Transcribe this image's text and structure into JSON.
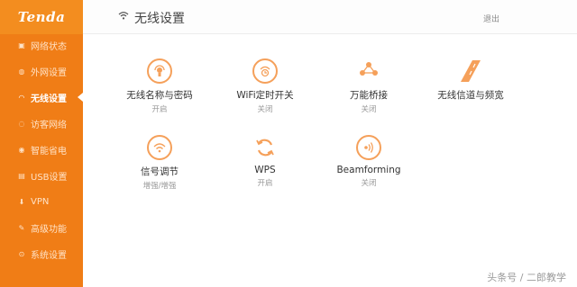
{
  "brand": {
    "logo": "Tenda",
    "accent": "#f07d16",
    "icon_color": "#f5a05a"
  },
  "sidebar": {
    "items": [
      {
        "label": "网络状态",
        "icon": "network-status-icon",
        "glyph": "▣",
        "active": false
      },
      {
        "label": "外网设置",
        "icon": "globe-icon",
        "glyph": "◍",
        "active": false
      },
      {
        "label": "无线设置",
        "icon": "wifi-icon",
        "glyph": "◠",
        "active": true
      },
      {
        "label": "访客网络",
        "icon": "guest-network-icon",
        "glyph": "◌",
        "active": false
      },
      {
        "label": "智能省电",
        "icon": "bulb-icon",
        "glyph": "◉",
        "active": false
      },
      {
        "label": "USB设置",
        "icon": "usb-icon",
        "glyph": "▤",
        "active": false
      },
      {
        "label": "VPN",
        "icon": "vpn-icon",
        "glyph": "⬇",
        "active": false
      },
      {
        "label": "高级功能",
        "icon": "tools-icon",
        "glyph": "✎",
        "active": false
      },
      {
        "label": "系统设置",
        "icon": "settings-icon",
        "glyph": "⊙",
        "active": false
      }
    ]
  },
  "header": {
    "title": "无线设置",
    "logout": "退出"
  },
  "tiles": [
    {
      "label": "无线名称与密码",
      "status": "开启",
      "icon": "signal-lock-icon"
    },
    {
      "label": "WiFi定时开关",
      "status": "关闭",
      "icon": "timer-icon"
    },
    {
      "label": "万能桥接",
      "status": "关闭",
      "icon": "bridge-icon"
    },
    {
      "label": "无线信道与频宽",
      "status": "",
      "icon": "road-icon"
    },
    {
      "label": "信号调节",
      "status": "增强/增强",
      "icon": "signal-adjust-icon"
    },
    {
      "label": "WPS",
      "status": "开启",
      "icon": "wps-icon"
    },
    {
      "label": "Beamforming",
      "status": "关闭",
      "icon": "beamforming-icon"
    }
  ],
  "watermark": "头条号 / 二郎教学"
}
